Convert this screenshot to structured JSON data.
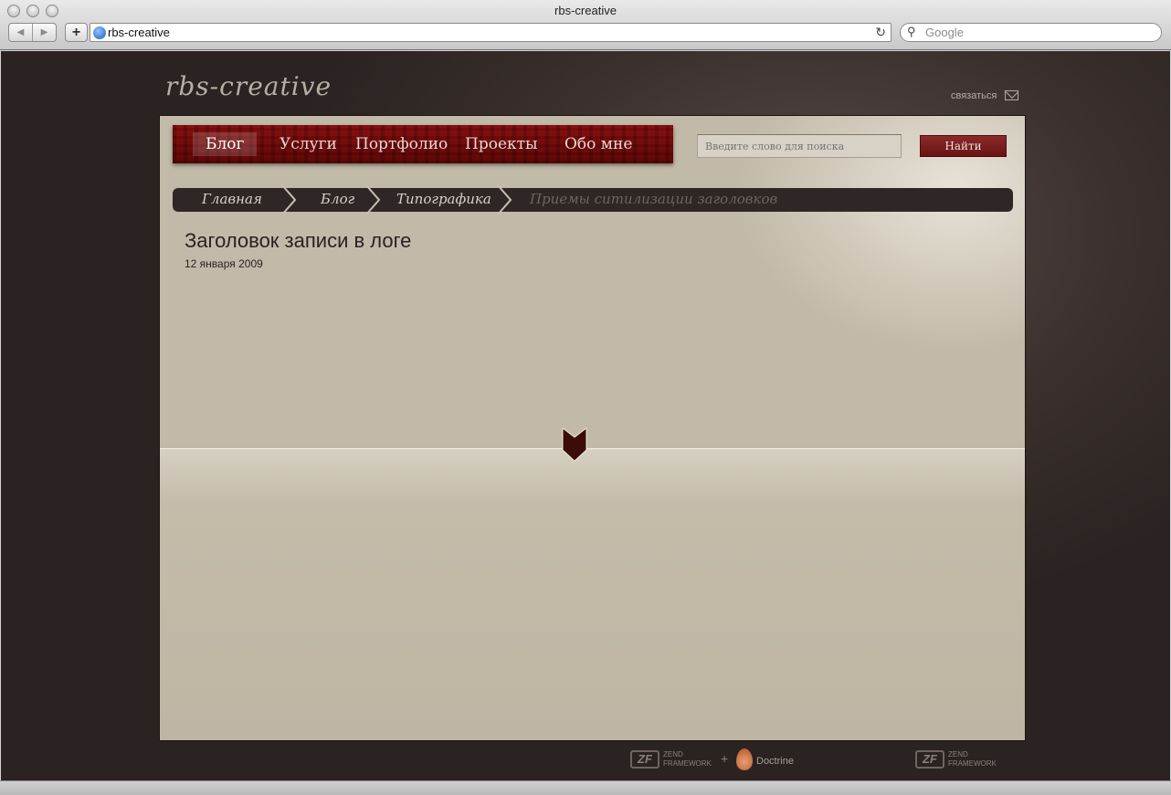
{
  "browser": {
    "window_title": "rbs-creative",
    "back_symbol": "◀",
    "forward_symbol": "▶",
    "add_symbol": "+",
    "url": "rbs-creative",
    "reload_symbol": "↻",
    "search_placeholder": "Google",
    "search_symbol": "⚲"
  },
  "site": {
    "logo": "rbs-creative",
    "contact_label": "связаться"
  },
  "nav": {
    "items": [
      {
        "label": "Блог",
        "active": true
      },
      {
        "label": "Услуги",
        "active": false
      },
      {
        "label": "Портфолио",
        "active": false
      },
      {
        "label": "Проекты",
        "active": false
      },
      {
        "label": "Обо мне",
        "active": false
      }
    ]
  },
  "search": {
    "placeholder": "Введите слово для поиска",
    "button_label": "Найти"
  },
  "breadcrumbs": {
    "items": [
      "Главная",
      "Блог",
      "Типографика",
      "Приемы ситилизации заголовков"
    ]
  },
  "post": {
    "title": "Заголовок записи в логе",
    "date": "12 января 2009"
  },
  "footer": {
    "zf_mark": "ZF",
    "zf_line1": "ZEND",
    "zf_line2": "FRAMEWORK",
    "plus": "+",
    "doctrine": "Doctrine"
  },
  "colors": {
    "nav_red": "#7a0c0c",
    "breadcrumb_bg": "#2f2725",
    "panel_bg": "#c2baa8",
    "page_bg": "#3a302d"
  }
}
